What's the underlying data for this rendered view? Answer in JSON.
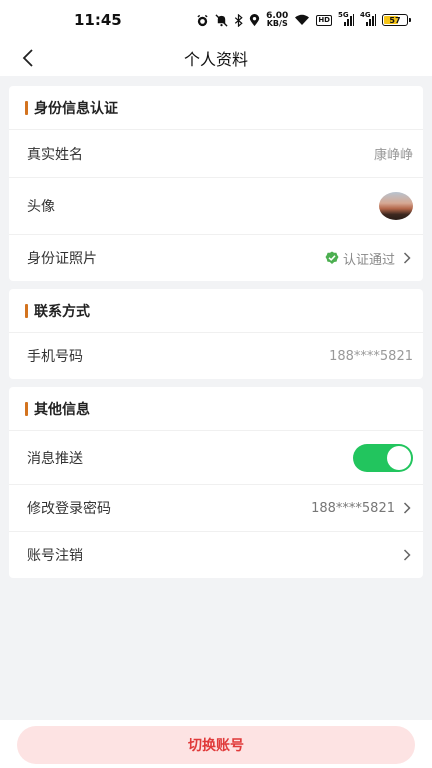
{
  "status": {
    "time": "11:45",
    "net_speed_value": "6.00",
    "net_speed_unit": "KB/S",
    "hd_label": "HD",
    "sig1_label": "5G",
    "sig2_label": "4G",
    "battery": "57"
  },
  "header": {
    "title": "个人资料"
  },
  "identity": {
    "section_title": "身份信息认证",
    "real_name_label": "真实姓名",
    "real_name_value": "康峥峥",
    "avatar_label": "头像",
    "id_photo_label": "身份证照片",
    "id_photo_status": "认证通过"
  },
  "contact": {
    "section_title": "联系方式",
    "phone_label": "手机号码",
    "phone_value": "188****5821"
  },
  "other": {
    "section_title": "其他信息",
    "push_label": "消息推送",
    "push_enabled": true,
    "password_label": "修改登录密码",
    "password_value": "188****5821",
    "cancel_label": "账号注销"
  },
  "footer": {
    "switch_account_label": "切换账号"
  },
  "colors": {
    "accent": "#d3731f",
    "toggle_on": "#22c55e",
    "verify_green": "#4caf50",
    "danger": "#e03a3a"
  }
}
